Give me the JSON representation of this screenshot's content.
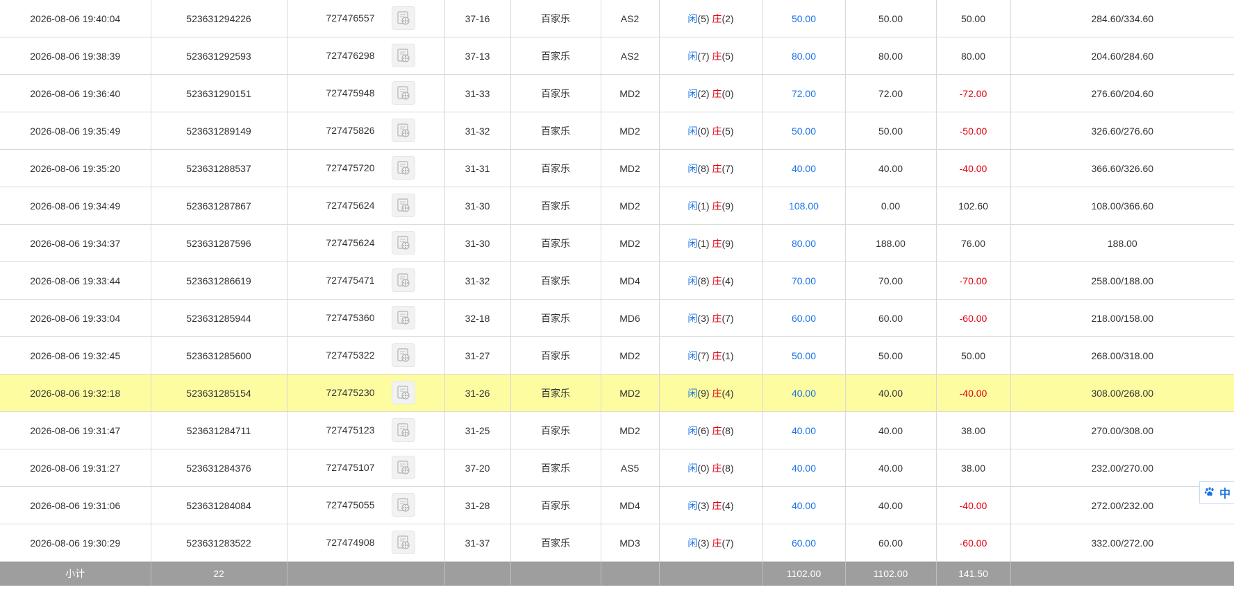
{
  "rows": [
    {
      "time": "2026-08-06 19:40:04",
      "bet_id": "523631294226",
      "round_id": "727476557",
      "table": "37-16",
      "game": "百家乐",
      "tbl_code": "AS2",
      "player_label": "闲",
      "player_pts": "(5)",
      "banker_label": "庄",
      "banker_pts": "(2)",
      "bet": "50.00",
      "valid": "50.00",
      "win_loss": "50.00",
      "balance": "284.60/334.60",
      "highlight": false
    },
    {
      "time": "2026-08-06 19:38:39",
      "bet_id": "523631292593",
      "round_id": "727476298",
      "table": "37-13",
      "game": "百家乐",
      "tbl_code": "AS2",
      "player_label": "闲",
      "player_pts": "(7)",
      "banker_label": "庄",
      "banker_pts": "(5)",
      "bet": "80.00",
      "valid": "80.00",
      "win_loss": "80.00",
      "balance": "204.60/284.60",
      "highlight": false
    },
    {
      "time": "2026-08-06 19:36:40",
      "bet_id": "523631290151",
      "round_id": "727475948",
      "table": "31-33",
      "game": "百家乐",
      "tbl_code": "MD2",
      "player_label": "闲",
      "player_pts": "(2)",
      "banker_label": "庄",
      "banker_pts": "(0)",
      "bet": "72.00",
      "valid": "72.00",
      "win_loss": "-72.00",
      "balance": "276.60/204.60",
      "highlight": false
    },
    {
      "time": "2026-08-06 19:35:49",
      "bet_id": "523631289149",
      "round_id": "727475826",
      "table": "31-32",
      "game": "百家乐",
      "tbl_code": "MD2",
      "player_label": "闲",
      "player_pts": "(0)",
      "banker_label": "庄",
      "banker_pts": "(5)",
      "bet": "50.00",
      "valid": "50.00",
      "win_loss": "-50.00",
      "balance": "326.60/276.60",
      "highlight": false
    },
    {
      "time": "2026-08-06 19:35:20",
      "bet_id": "523631288537",
      "round_id": "727475720",
      "table": "31-31",
      "game": "百家乐",
      "tbl_code": "MD2",
      "player_label": "闲",
      "player_pts": "(8)",
      "banker_label": "庄",
      "banker_pts": "(7)",
      "bet": "40.00",
      "valid": "40.00",
      "win_loss": "-40.00",
      "balance": "366.60/326.60",
      "highlight": false
    },
    {
      "time": "2026-08-06 19:34:49",
      "bet_id": "523631287867",
      "round_id": "727475624",
      "table": "31-30",
      "game": "百家乐",
      "tbl_code": "MD2",
      "player_label": "闲",
      "player_pts": "(1)",
      "banker_label": "庄",
      "banker_pts": "(9)",
      "bet": "108.00",
      "valid": "0.00",
      "win_loss": "102.60",
      "balance": "108.00/366.60",
      "highlight": false
    },
    {
      "time": "2026-08-06 19:34:37",
      "bet_id": "523631287596",
      "round_id": "727475624",
      "table": "31-30",
      "game": "百家乐",
      "tbl_code": "MD2",
      "player_label": "闲",
      "player_pts": "(1)",
      "banker_label": "庄",
      "banker_pts": "(9)",
      "bet": "80.00",
      "valid": "188.00",
      "win_loss": "76.00",
      "balance": "188.00",
      "highlight": false
    },
    {
      "time": "2026-08-06 19:33:44",
      "bet_id": "523631286619",
      "round_id": "727475471",
      "table": "31-32",
      "game": "百家乐",
      "tbl_code": "MD4",
      "player_label": "闲",
      "player_pts": "(8)",
      "banker_label": "庄",
      "banker_pts": "(4)",
      "bet": "70.00",
      "valid": "70.00",
      "win_loss": "-70.00",
      "balance": "258.00/188.00",
      "highlight": false
    },
    {
      "time": "2026-08-06 19:33:04",
      "bet_id": "523631285944",
      "round_id": "727475360",
      "table": "32-18",
      "game": "百家乐",
      "tbl_code": "MD6",
      "player_label": "闲",
      "player_pts": "(3)",
      "banker_label": "庄",
      "banker_pts": "(7)",
      "bet": "60.00",
      "valid": "60.00",
      "win_loss": "-60.00",
      "balance": "218.00/158.00",
      "highlight": false
    },
    {
      "time": "2026-08-06 19:32:45",
      "bet_id": "523631285600",
      "round_id": "727475322",
      "table": "31-27",
      "game": "百家乐",
      "tbl_code": "MD2",
      "player_label": "闲",
      "player_pts": "(7)",
      "banker_label": "庄",
      "banker_pts": "(1)",
      "bet": "50.00",
      "valid": "50.00",
      "win_loss": "50.00",
      "balance": "268.00/318.00",
      "highlight": false
    },
    {
      "time": "2026-08-06 19:32:18",
      "bet_id": "523631285154",
      "round_id": "727475230",
      "table": "31-26",
      "game": "百家乐",
      "tbl_code": "MD2",
      "player_label": "闲",
      "player_pts": "(9)",
      "banker_label": "庄",
      "banker_pts": "(4)",
      "bet": "40.00",
      "valid": "40.00",
      "win_loss": "-40.00",
      "balance": "308.00/268.00",
      "highlight": true
    },
    {
      "time": "2026-08-06 19:31:47",
      "bet_id": "523631284711",
      "round_id": "727475123",
      "table": "31-25",
      "game": "百家乐",
      "tbl_code": "MD2",
      "player_label": "闲",
      "player_pts": "(6)",
      "banker_label": "庄",
      "banker_pts": "(8)",
      "bet": "40.00",
      "valid": "40.00",
      "win_loss": "38.00",
      "balance": "270.00/308.00",
      "highlight": false
    },
    {
      "time": "2026-08-06 19:31:27",
      "bet_id": "523631284376",
      "round_id": "727475107",
      "table": "37-20",
      "game": "百家乐",
      "tbl_code": "AS5",
      "player_label": "闲",
      "player_pts": "(0)",
      "banker_label": "庄",
      "banker_pts": "(8)",
      "bet": "40.00",
      "valid": "40.00",
      "win_loss": "38.00",
      "balance": "232.00/270.00",
      "highlight": false
    },
    {
      "time": "2026-08-06 19:31:06",
      "bet_id": "523631284084",
      "round_id": "727475055",
      "table": "31-28",
      "game": "百家乐",
      "tbl_code": "MD4",
      "player_label": "闲",
      "player_pts": "(3)",
      "banker_label": "庄",
      "banker_pts": "(4)",
      "bet": "40.00",
      "valid": "40.00",
      "win_loss": "-40.00",
      "balance": "272.00/232.00",
      "highlight": false
    },
    {
      "time": "2026-08-06 19:30:29",
      "bet_id": "523631283522",
      "round_id": "727474908",
      "table": "31-37",
      "game": "百家乐",
      "tbl_code": "MD3",
      "player_label": "闲",
      "player_pts": "(3)",
      "banker_label": "庄",
      "banker_pts": "(7)",
      "bet": "60.00",
      "valid": "60.00",
      "win_loss": "-60.00",
      "balance": "332.00/272.00",
      "highlight": false
    }
  ],
  "subtotal": {
    "label": "小计",
    "count": "22",
    "bet": "1102.00",
    "valid": "1102.00",
    "win_loss": "141.50"
  },
  "side_widget": {
    "icon": "paw-icon",
    "label": "中"
  },
  "colors": {
    "player": "#1a73e8",
    "banker": "#e3000f",
    "highlight_row": "#fdfca0",
    "subtotal_bg": "#9e9e9e"
  }
}
